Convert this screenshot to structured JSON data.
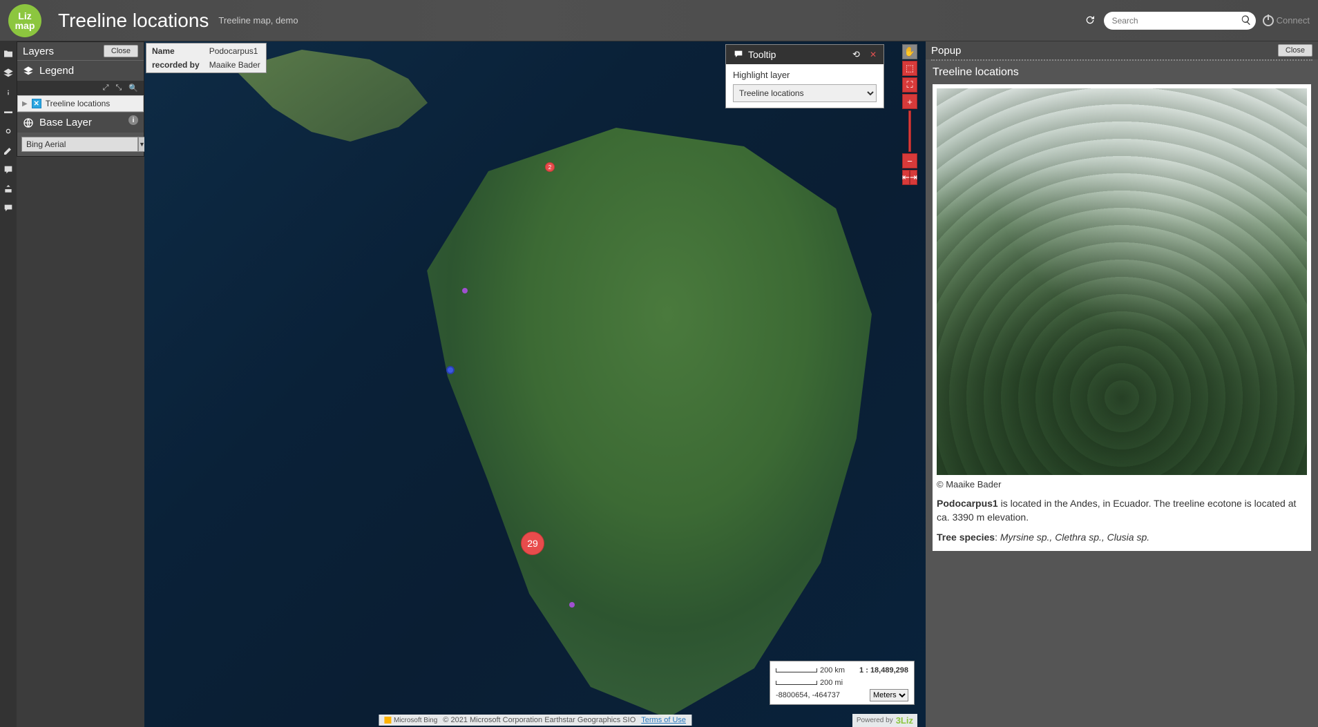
{
  "header": {
    "logo_text": "Liz\nmap",
    "title": "Treeline locations",
    "subtitle": "Treeline map, demo",
    "search_placeholder": "Search",
    "connect_label": "Connect"
  },
  "layers_panel": {
    "title": "Layers",
    "close": "Close",
    "legend_label": "Legend",
    "layer_name": "Treeline locations",
    "baselayer_label": "Base Layer",
    "baselayer_value": "Bing Aerial"
  },
  "info_box": {
    "rows": [
      {
        "k": "Name",
        "v": "Podocarpus1"
      },
      {
        "k": "recorded by",
        "v": "Maaike Bader"
      }
    ]
  },
  "tooltip": {
    "title": "Tooltip",
    "highlight_label": "Highlight layer",
    "selected": "Treeline locations"
  },
  "cluster_count": "29",
  "small_marker_count": "2",
  "scale": {
    "km": "200 km",
    "mi": "200 mi",
    "ratio": "1 : 18,489,298",
    "coords": "-8800654, -464737",
    "units": "Meters"
  },
  "attribution": {
    "bing": "Microsoft Bing",
    "text": "© 2021 Microsoft Corporation Earthstar Geographics SIO ",
    "terms": "Terms of Use",
    "powered_by": "Powered by",
    "brand": "3Liz"
  },
  "popup": {
    "title": "Popup",
    "close": "Close",
    "section_title": "Treeline locations",
    "copyright": "© Maaike Bader",
    "desc_name": "Podocarpus1",
    "desc_text": " is located in the Andes, in Ecuador. The treeline ecotone is located at ca. 3390 m elevation.",
    "species_label": "Tree species",
    "species_list": "Myrsine sp., Clethra sp., Clusia sp."
  }
}
